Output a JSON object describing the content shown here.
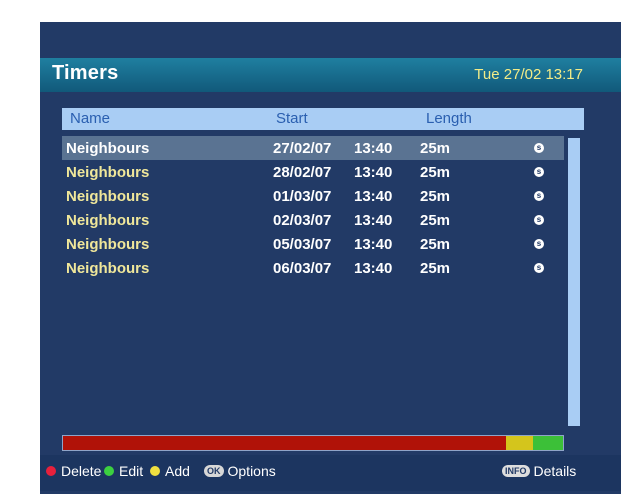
{
  "header": {
    "title": "Timers",
    "datetime": "Tue 27/02 13:17"
  },
  "columns": {
    "name": "Name",
    "start": "Start",
    "length": "Length"
  },
  "timers": [
    {
      "name": "Neighbours",
      "date": "27/02/07",
      "time": "13:40",
      "length": "25m",
      "badge": "s"
    },
    {
      "name": "Neighbours",
      "date": "28/02/07",
      "time": "13:40",
      "length": "25m",
      "badge": "s"
    },
    {
      "name": "Neighbours",
      "date": "01/03/07",
      "time": "13:40",
      "length": "25m",
      "badge": "s"
    },
    {
      "name": "Neighbours",
      "date": "02/03/07",
      "time": "13:40",
      "length": "25m",
      "badge": "s"
    },
    {
      "name": "Neighbours",
      "date": "05/03/07",
      "time": "13:40",
      "length": "25m",
      "badge": "s"
    },
    {
      "name": "Neighbours",
      "date": "06/03/07",
      "time": "13:40",
      "length": "25m",
      "badge": "s"
    }
  ],
  "selected_index": 0,
  "usage_bar": {
    "segments": [
      {
        "color": "#b01208",
        "fraction": 0.885
      },
      {
        "color": "#d4c51c",
        "fraction": 0.055
      },
      {
        "color": "#3cc038",
        "fraction": 0.06
      }
    ]
  },
  "footer": {
    "delete": {
      "label": "Delete",
      "color": "#e8203c"
    },
    "edit": {
      "label": "Edit",
      "color": "#3cd040"
    },
    "add": {
      "label": "Add",
      "color": "#f0e040"
    },
    "options": {
      "key": "OK",
      "label": "Options"
    },
    "details": {
      "key": "INFO",
      "label": "Details"
    }
  },
  "colors": {
    "panel_bg": "#223a66",
    "header_bg": "#1b6f92",
    "column_header_bg": "#a9cdf4",
    "selected_row_bg": "#5a7392",
    "name_text": "#f0e79a",
    "datetime_text": "#f2ec88"
  },
  "icons": {
    "red_button": "red-dot-icon",
    "green_button": "green-dot-icon",
    "yellow_button": "yellow-dot-icon",
    "ok_key": "ok-key-icon",
    "info_key": "info-key-icon",
    "series_badge": "series-s-icon"
  }
}
